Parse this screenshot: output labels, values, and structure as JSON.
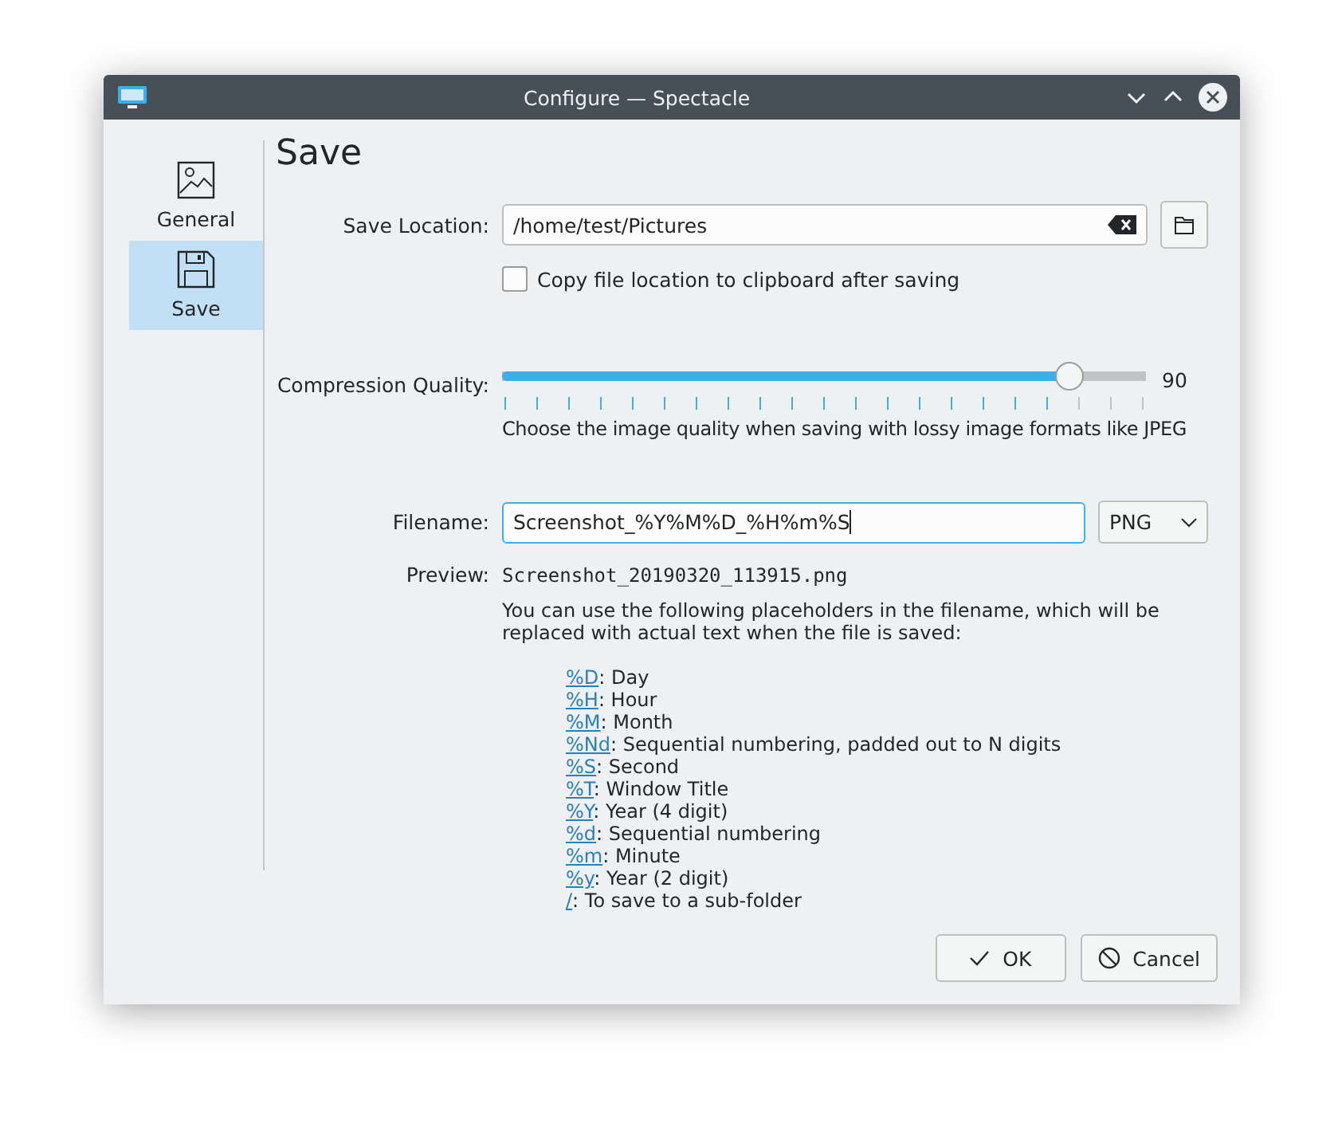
{
  "window": {
    "title": "Configure — Spectacle"
  },
  "sidebar": {
    "items": [
      {
        "label": "General",
        "kind": "image",
        "selected": false
      },
      {
        "label": "Save",
        "kind": "disk",
        "selected": true
      }
    ]
  },
  "page_title": "Save",
  "save_location": {
    "label": "Save Location:",
    "value": "/home/test/Pictures"
  },
  "copy_to_clipboard": {
    "label": "Copy file location to clipboard after saving",
    "checked": false
  },
  "compression": {
    "label": "Compression Quality:",
    "level": 0.88,
    "reading": "90",
    "hint": "Choose the image quality when saving with lossy image formats like JPEG"
  },
  "filename": {
    "label": "Filename:",
    "value": "Screenshot_%Y%M%D_%H%m%S",
    "format": "PNG"
  },
  "preview": {
    "label": "Preview:",
    "value": "Screenshot_20190320_113915.png"
  },
  "help_text": "You can use the following placeholders in the filename, which will be replaced with actual text when the file is saved:",
  "placeholders": [
    {
      "code": "%D",
      "text": ": Day"
    },
    {
      "code": "%H",
      "text": ": Hour"
    },
    {
      "code": "%M",
      "text": ": Month"
    },
    {
      "code": "%Nd",
      "text": ": Sequential numbering, padded out to N digits"
    },
    {
      "code": "%S",
      "text": ": Second"
    },
    {
      "code": "%T",
      "text": ": Window Title"
    },
    {
      "code": "%Y",
      "text": ": Year (4 digit)"
    },
    {
      "code": "%d",
      "text": ": Sequential numbering"
    },
    {
      "code": "%m",
      "text": ": Minute"
    },
    {
      "code": "%y",
      "text": ": Year (2 digit)"
    },
    {
      "code": "/",
      "text": ": To save to a sub-folder"
    }
  ],
  "buttons": [
    {
      "label": "OK",
      "kind": "ok"
    },
    {
      "label": "Cancel",
      "kind": "cancel"
    }
  ]
}
